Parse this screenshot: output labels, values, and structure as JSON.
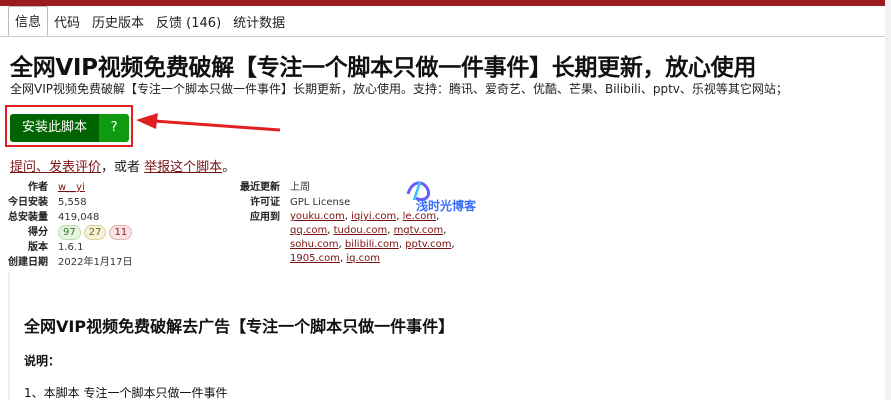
{
  "tabs": [
    {
      "label": "信息",
      "active": true
    },
    {
      "label": "代码"
    },
    {
      "label": "历史版本"
    },
    {
      "label": "反馈 (146)"
    },
    {
      "label": "统计数据"
    }
  ],
  "script": {
    "title": "全网VIP视频免费破解【专注一个脚本只做一件事件】长期更新，放心使用",
    "description": "全网VIP视频免费破解【专注一个脚本只做一件事件】长期更新，放心使用。支持：腾讯、爱奇艺、优酷、芒果、Bilibili、pptv、乐视等其它网站；"
  },
  "install": {
    "button_label": "安装此脚本",
    "help_label": "?"
  },
  "feedback": {
    "ask_link": "提问、发表评价",
    "middle_text": "，或者",
    "report_link": "举报这个脚本",
    "end_text": "。"
  },
  "meta_left": {
    "author_label": "作者",
    "author_value": "w__yi",
    "today_label": "今日安装",
    "today_value": "5,558",
    "total_label": "总安装量",
    "total_value": "419,048",
    "score_label": "得分",
    "scores": [
      "97",
      "27",
      "11"
    ],
    "version_label": "版本",
    "version_value": "1.6.1",
    "created_label": "创建日期",
    "created_value": "2022年1月17日"
  },
  "meta_right": {
    "updated_label": "最近更新",
    "updated_value": "上周",
    "license_label": "许可证",
    "license_value": "GPL License",
    "applies_label": "应用到",
    "applies_lines": [
      [
        "youku.com",
        "iqiyi.com",
        "le.com"
      ],
      [
        "qq.com",
        "tudou.com",
        "mgtv.com"
      ],
      [
        "sohu.com",
        "bilibili.com",
        "pptv.com"
      ],
      [
        "1905.com",
        "iq.com"
      ]
    ]
  },
  "watermark": {
    "text": "浅时光博客"
  },
  "content": {
    "heading": "全网VIP视频免费破解去广告【专注一个脚本只做一件事件】",
    "note": "说明：",
    "item1": "1、本脚本 专注一个脚本只做一件事件"
  },
  "colors": {
    "brand": "#9b1c1c",
    "install_green": "#006400",
    "help_green": "#109a10",
    "highlight_red": "#e02020",
    "link": "#7a1212"
  }
}
